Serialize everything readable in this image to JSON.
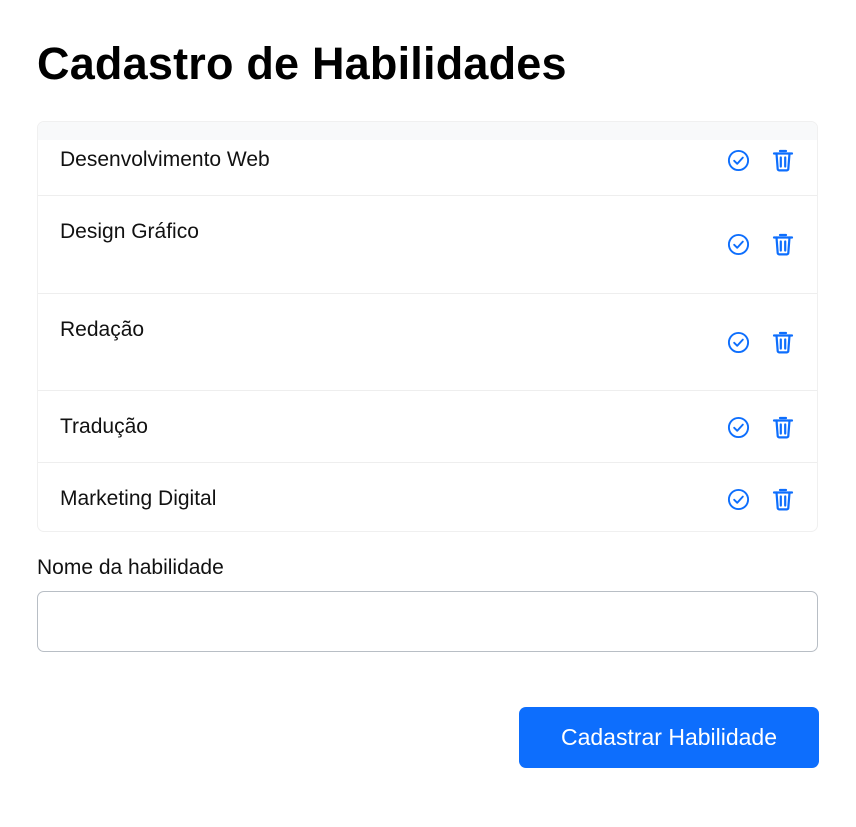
{
  "page": {
    "title": "Cadastro de Habilidades"
  },
  "skills": {
    "items": [
      {
        "name": "Desenvolvimento Web",
        "confirm_icon": "check-circle-icon",
        "delete_icon": "trash-icon"
      },
      {
        "name": "Design Gráfico",
        "confirm_icon": "check-circle-icon",
        "delete_icon": "trash-icon"
      },
      {
        "name": "Redação",
        "confirm_icon": "check-circle-icon",
        "delete_icon": "trash-icon"
      },
      {
        "name": "Tradução",
        "confirm_icon": "check-circle-icon",
        "delete_icon": "trash-icon"
      },
      {
        "name": "Marketing Digital",
        "confirm_icon": "check-circle-icon",
        "delete_icon": "trash-icon"
      }
    ]
  },
  "form": {
    "label": "Nome da habilidade",
    "input_value": "",
    "input_placeholder": "",
    "submit_label": "Cadastrar Habilidade"
  },
  "colors": {
    "accent": "#0d6efd",
    "text": "#111111",
    "border": "#b8bec5"
  }
}
